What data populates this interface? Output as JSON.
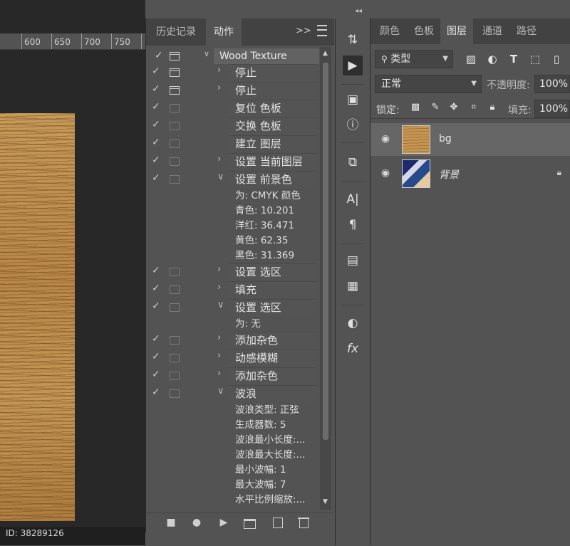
{
  "ruler": {
    "ticks": [
      "600",
      "650",
      "700",
      "750"
    ]
  },
  "watermark": "ID: 38289126",
  "actions_panel": {
    "tabs": [
      "历史记录",
      "动作"
    ],
    "active_tab": "动作",
    "menu_glyph": ">>",
    "set_name": "Wood Texture",
    "rows": [
      {
        "label": "停止",
        "check": true,
        "dialog": "on",
        "expand": "closed"
      },
      {
        "label": "停止",
        "check": true,
        "dialog": "on",
        "expand": "closed"
      },
      {
        "label": "复位 色板",
        "check": true,
        "dialog": "off",
        "expand": "none"
      },
      {
        "label": "交换 色板",
        "check": true,
        "dialog": "off",
        "expand": "none"
      },
      {
        "label": "建立 图层",
        "check": true,
        "dialog": "off",
        "expand": "none"
      },
      {
        "label": "设置 当前图层",
        "check": true,
        "dialog": "off",
        "expand": "closed"
      },
      {
        "label": "设置 前景色",
        "check": true,
        "dialog": "off",
        "expand": "open"
      },
      {
        "sub": "为: CMYK 颜色"
      },
      {
        "sub": "青色: 10.201"
      },
      {
        "sub": "洋红: 36.471"
      },
      {
        "sub": "黄色: 62.35"
      },
      {
        "sub": "黑色: 31.369"
      },
      {
        "label": "设置 选区",
        "check": true,
        "dialog": "off",
        "expand": "closed"
      },
      {
        "label": "填充",
        "check": true,
        "dialog": "off",
        "expand": "closed"
      },
      {
        "label": "设置 选区",
        "check": true,
        "dialog": "off",
        "expand": "open"
      },
      {
        "sub": "为: 无"
      },
      {
        "label": "添加杂色",
        "check": true,
        "dialog": "off",
        "expand": "closed"
      },
      {
        "label": "动感模糊",
        "check": true,
        "dialog": "off",
        "expand": "closed"
      },
      {
        "label": "添加杂色",
        "check": true,
        "dialog": "off",
        "expand": "closed"
      },
      {
        "label": "波浪",
        "check": true,
        "dialog": "off",
        "expand": "open"
      },
      {
        "sub": "波浪类型: 正弦"
      },
      {
        "sub": "生成器数: 5"
      },
      {
        "sub": "波浪最小长度:..."
      },
      {
        "sub": "波浪最大长度:..."
      },
      {
        "sub": "最小波幅: 1"
      },
      {
        "sub": "最大波幅: 7"
      },
      {
        "sub": "水平比例缩放:..."
      }
    ]
  },
  "layers_panel": {
    "tabs": [
      "颜色",
      "色板",
      "图层",
      "通道",
      "路径"
    ],
    "active_tab": "图层",
    "filter_label": "类型",
    "blend_mode": "正常",
    "opacity_label": "不透明度:",
    "opacity_value": "100%",
    "lock_label": "锁定:",
    "fill_label": "填充:",
    "fill_value": "100%",
    "layers": [
      {
        "name": "bg",
        "selected": true,
        "locked": false
      },
      {
        "name": "背景",
        "selected": false,
        "locked": true
      }
    ]
  },
  "colors": {
    "panel": "#535353",
    "tabbar": "#424242",
    "canvas": "#282828",
    "selected_layer": "#666666"
  }
}
